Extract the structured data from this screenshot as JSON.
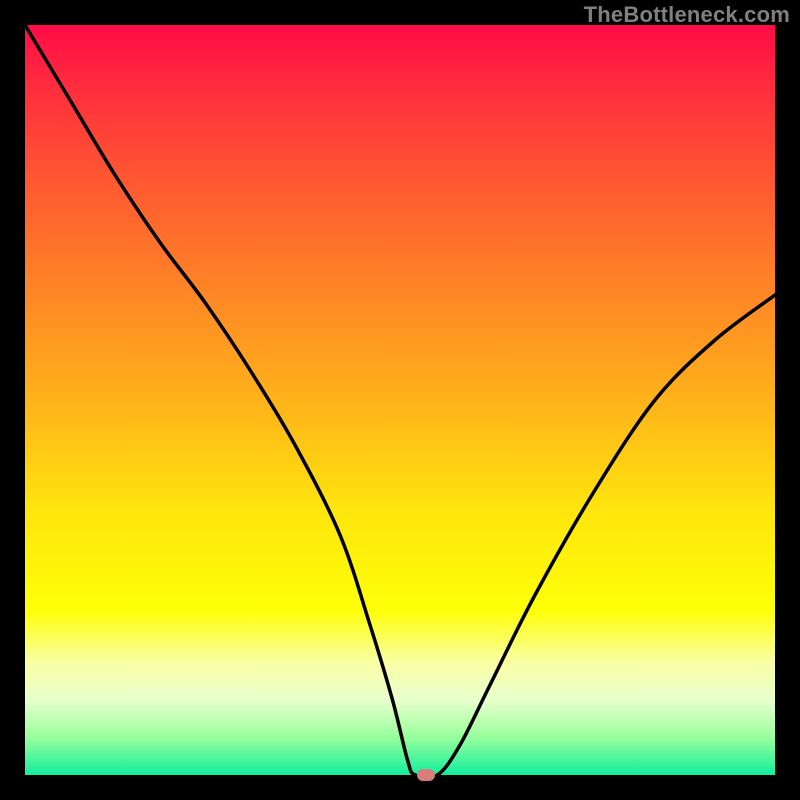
{
  "watermark": "TheBottleneck.com",
  "chart_data": {
    "type": "line",
    "title": "",
    "xlabel": "",
    "ylabel": "",
    "xlim": [
      0,
      100
    ],
    "ylim": [
      0,
      100
    ],
    "series": [
      {
        "name": "bottleneck-curve",
        "x": [
          0,
          6,
          12,
          18,
          24,
          30,
          36,
          42,
          46,
          49,
          51,
          52,
          55,
          58,
          62,
          68,
          76,
          84,
          92,
          100
        ],
        "values": [
          100,
          90,
          80,
          71,
          63,
          54,
          44,
          32,
          20,
          10,
          2,
          0,
          0,
          4,
          12,
          24,
          38,
          50,
          58,
          64
        ]
      }
    ],
    "marker": {
      "x": 53.5,
      "y": 0,
      "color": "#d77e7a"
    },
    "gradient_stops": [
      {
        "pos": 0,
        "color": "#ff0b46"
      },
      {
        "pos": 8,
        "color": "#ff2c3e"
      },
      {
        "pos": 20,
        "color": "#ff5532"
      },
      {
        "pos": 35,
        "color": "#ff8426"
      },
      {
        "pos": 50,
        "color": "#ffb21a"
      },
      {
        "pos": 65,
        "color": "#ffe60d"
      },
      {
        "pos": 78,
        "color": "#feff07"
      },
      {
        "pos": 85,
        "color": "#f9ffa4"
      },
      {
        "pos": 90,
        "color": "#e8ffcd"
      },
      {
        "pos": 95,
        "color": "#97ff9b"
      },
      {
        "pos": 100,
        "color": "#11ee9d"
      }
    ]
  }
}
